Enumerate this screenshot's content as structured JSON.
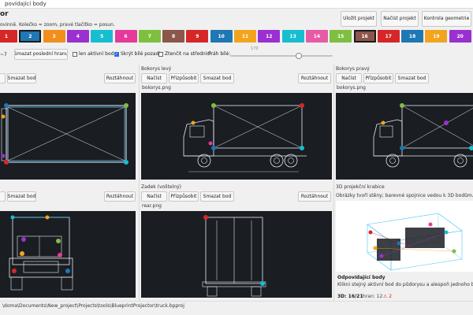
{
  "window": {
    "title": "povídající body"
  },
  "toolbar": {
    "heading": "or",
    "hint": "ovinně. Kolečko = zoom, pravé tlačítko = posun.",
    "save_project": "Uložit projekt",
    "load_project": "Načíst projekt",
    "check_geometry": "Kontrola geometrie"
  },
  "swatches": [
    {
      "label": "1",
      "color": "#d62728",
      "text": "#ffffff"
    },
    {
      "label": "2",
      "color": "#1f77b4",
      "text": "#ffffff",
      "selected": true
    },
    {
      "label": "3",
      "color": "#f28e1c",
      "text": "#ffffff"
    },
    {
      "label": "4",
      "color": "#9b30d0",
      "text": "#ffffff"
    },
    {
      "label": "5",
      "color": "#17becf",
      "text": "#ffffff"
    },
    {
      "label": "6",
      "color": "#e6399b",
      "text": "#ffffff"
    },
    {
      "label": "7",
      "color": "#7fbf3f",
      "text": "#ffffff"
    },
    {
      "label": "8",
      "color": "#8c564b",
      "text": "#ffffff"
    },
    {
      "label": "9",
      "color": "#d62728",
      "text": "#ffffff"
    },
    {
      "label": "10",
      "color": "#1f77b4",
      "text": "#ffffff"
    },
    {
      "label": "11",
      "color": "#f2a51c",
      "text": "#ffffff"
    },
    {
      "label": "12",
      "color": "#9b30d0",
      "text": "#ffffff"
    },
    {
      "label": "13",
      "color": "#17becf",
      "text": "#ffffff"
    },
    {
      "label": "14",
      "color": "#e75aa6",
      "text": "#ffffff"
    },
    {
      "label": "15",
      "color": "#7fbf3f",
      "text": "#ffffff"
    },
    {
      "label": "16",
      "color": "#8c564b",
      "text": "#ffffff",
      "selected": true
    },
    {
      "label": "17",
      "color": "#d62728",
      "text": "#ffffff"
    },
    {
      "label": "18",
      "color": "#1f77b4",
      "text": "#ffffff"
    },
    {
      "label": "19",
      "color": "#f2a51c",
      "text": "#ffffff"
    },
    {
      "label": "20",
      "color": "#9b30d0",
      "text": "#ffffff"
    }
  ],
  "options": {
    "counter": "~7",
    "delete_last_edge": "Smazat poslední hranu",
    "only_active": "len aktivní bod",
    "hide_white_bg": "Skrýt bílé pozadí",
    "dim_center": "Ztenčit na středníci",
    "white_threshold_label": "Práh bílé:",
    "white_threshold_value": "170",
    "white_threshold_fraction": 0.67
  },
  "panels": {
    "top": {
      "name": "",
      "file": "",
      "delete_point": "Smazat bod",
      "pull": "Roztáhnout"
    },
    "side_left": {
      "name": "Bokorys levý",
      "file": "bokorys.png",
      "load": "Načíst",
      "fit": "Přizpůsobit",
      "delete_point": "Smazat bod",
      "pull": "Roztáhnout"
    },
    "side_right": {
      "name": "Bokorys pravý",
      "file": "bokorys.png",
      "load": "Načíst",
      "fit": "Přizpůsobit",
      "delete_point": "Smazat bod"
    },
    "front": {
      "delete_point": "Smazat bod",
      "pull": "Roztáhnout"
    },
    "rear": {
      "name": "Zadek (volitelný)",
      "file": "rear.png",
      "load": "Načíst",
      "fit": "Přizpůsobit",
      "delete_point": "Smazat bod",
      "pull": "Roztáhnout"
    },
    "preview3d": {
      "name": "3D projekční krabice",
      "description": "Obrázky tvoří stěny; barevné spojnice vedou k 3D bodům. Levým ta",
      "points_heading": "Odpovídající body",
      "points_hint": "Klikni stejný aktivní bod do půdorysu a alespoň jednoho boku.",
      "stat_3d": "3D: 16/21",
      "stat_edges": "hran: 12",
      "stat_warn": "⚠ 2"
    }
  },
  "status": {
    "path": "\\doma\\Documents\\New_project\\Projects\\tools\\BlueprintProjector\\truck.bpproj"
  },
  "colors": {
    "canvas_bg": "#1a1d22",
    "line": "#e8eef5",
    "accent_line": "#4fc3f7",
    "button_bg": "#f7f7f7"
  }
}
